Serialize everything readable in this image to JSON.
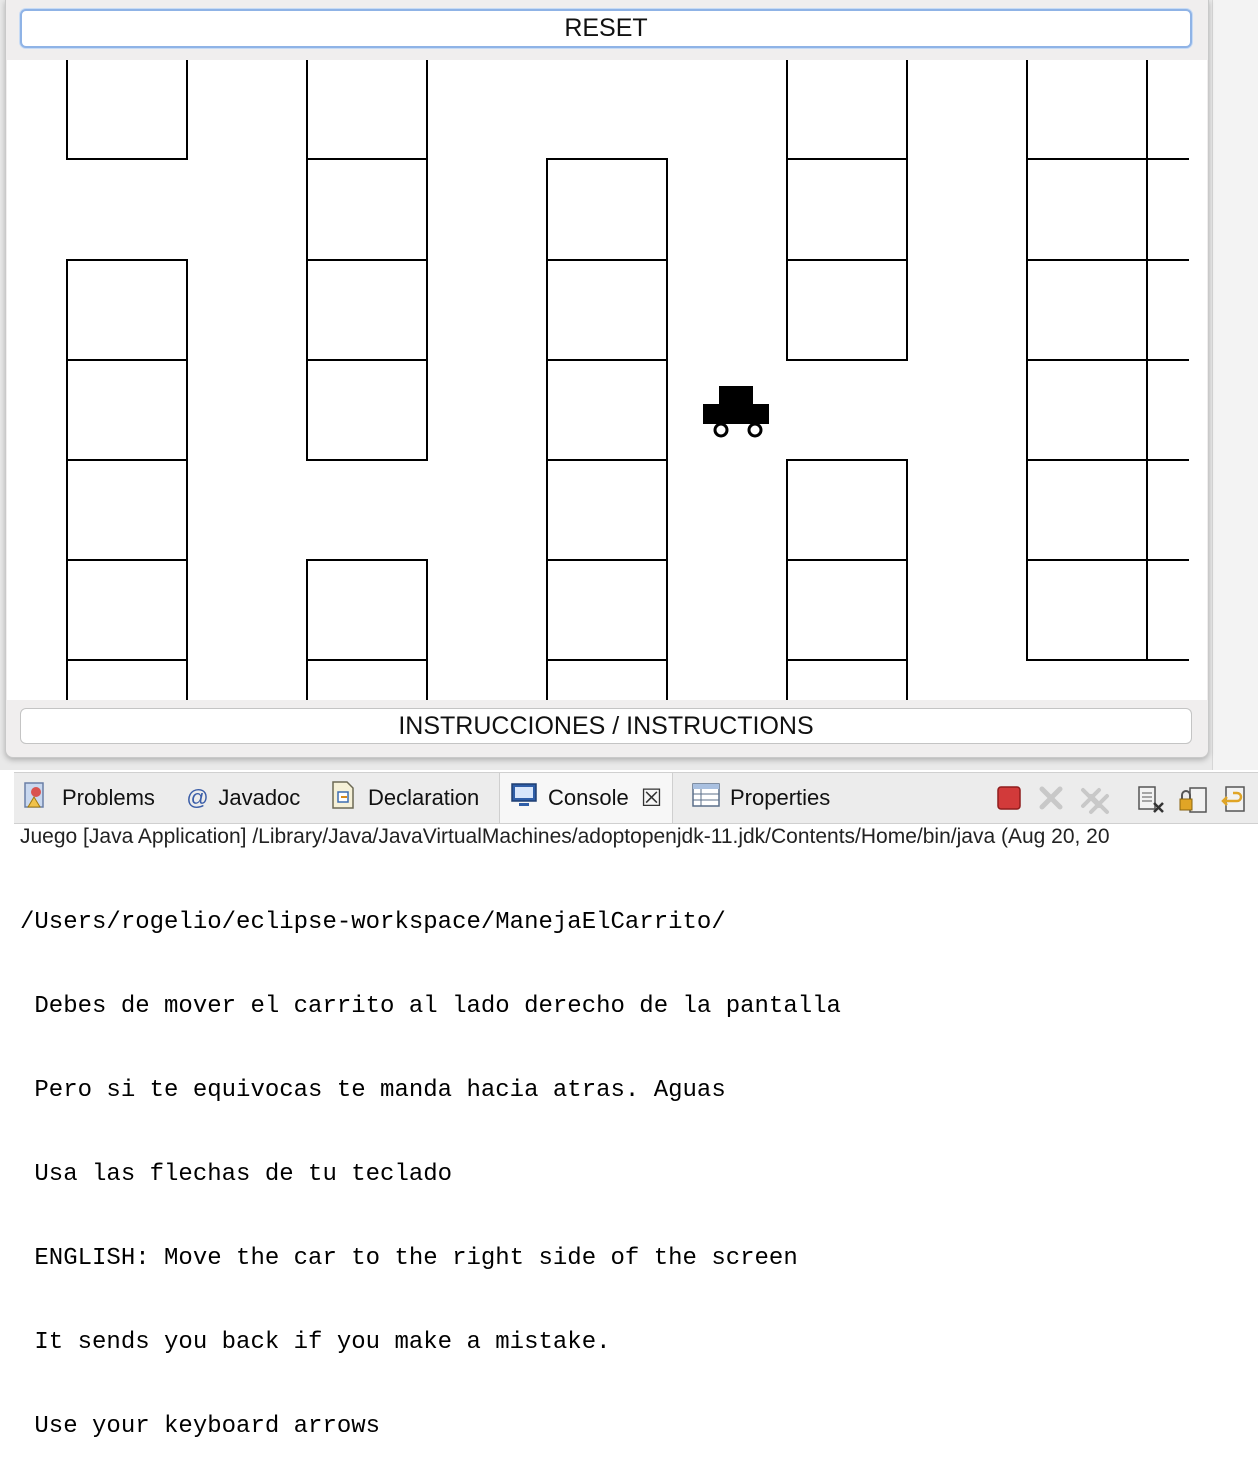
{
  "game": {
    "reset_label": "RESET",
    "instructions_label": "INSTRUCCIONES / INSTRUCTIONS"
  },
  "tabs": [
    {
      "label": "Problems",
      "icon": "problems-icon"
    },
    {
      "label": "Javadoc",
      "icon": "javadoc-at-icon",
      "glyph": "@"
    },
    {
      "label": "Declaration",
      "icon": "declaration-icon"
    },
    {
      "label": "Console",
      "icon": "console-icon",
      "close_glyph": "☒"
    },
    {
      "label": "Properties",
      "icon": "properties-icon"
    }
  ],
  "console": {
    "header": "Juego [Java Application] /Library/Java/JavaVirtualMachines/adoptopenjdk-11.jdk/Contents/Home/bin/java  (Aug 20, 20",
    "lines": [
      "/Users/rogelio/eclipse-workspace/ManejaElCarrito/",
      " Debes de mover el carrito al lado derecho de la pantalla",
      " Pero si te equivocas te manda hacia atras. Aguas",
      " Usa las flechas de tu teclado",
      " ENGLISH: Move the car to the right side of the screen",
      " It sends you back if you make a mistake.",
      " Use your keyboard arrows"
    ]
  },
  "colors": {
    "terminate_red": "#d23a3a",
    "focus_blue": "#8fb3e6"
  }
}
